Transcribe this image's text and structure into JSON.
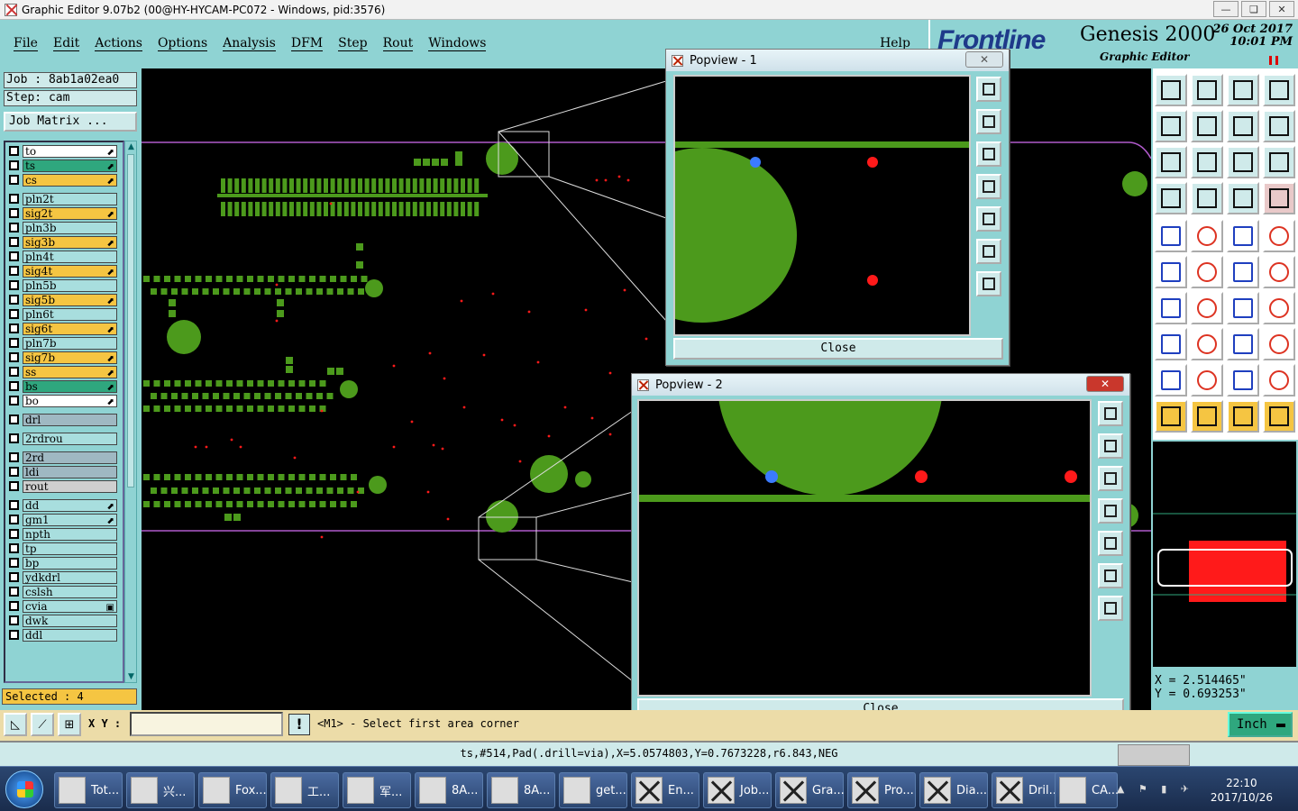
{
  "window": {
    "title": "Graphic Editor 9.07b2 (00@HY-HYCAM-PC072 - Windows, pid:3576)",
    "buttons": [
      "—",
      "❏",
      "✕"
    ]
  },
  "menu": {
    "items": [
      "File",
      "Edit",
      "Actions",
      "Options",
      "Analysis",
      "DFM",
      "Step",
      "Rout",
      "Windows"
    ],
    "help": "Help"
  },
  "brand": {
    "logo": "Frontline",
    "product": "Genesis 2000",
    "date": "26 Oct 2017",
    "time": "10:01 PM",
    "subtitle": "Graphic Editor"
  },
  "left": {
    "job": "Job : 8ab1a02ea0",
    "step": "Step: cam",
    "job_matrix": "Job Matrix ...",
    "selected": "Selected : 4",
    "layers": [
      {
        "name": "to",
        "color": "#ffffff",
        "arrow": "⬈"
      },
      {
        "name": "ts",
        "color": "#2fa77e",
        "arrow": "⬈"
      },
      {
        "name": "cs",
        "color": "#f5c542",
        "arrow": "⬈"
      },
      {
        "name": "pln2t",
        "color": "#a8dede",
        "arrow": ""
      },
      {
        "name": "sig2t",
        "color": "#f5c542",
        "arrow": "⬈"
      },
      {
        "name": "pln3b",
        "color": "#a8dede",
        "arrow": ""
      },
      {
        "name": "sig3b",
        "color": "#f5c542",
        "arrow": "⬈"
      },
      {
        "name": "pln4t",
        "color": "#a8dede",
        "arrow": ""
      },
      {
        "name": "sig4t",
        "color": "#f5c542",
        "arrow": "⬈"
      },
      {
        "name": "pln5b",
        "color": "#a8dede",
        "arrow": ""
      },
      {
        "name": "sig5b",
        "color": "#f5c542",
        "arrow": "⬈"
      },
      {
        "name": "pln6t",
        "color": "#a8dede",
        "arrow": ""
      },
      {
        "name": "sig6t",
        "color": "#f5c542",
        "arrow": "⬈"
      },
      {
        "name": "pln7b",
        "color": "#a8dede",
        "arrow": ""
      },
      {
        "name": "sig7b",
        "color": "#f5c542",
        "arrow": "⬈"
      },
      {
        "name": "ss",
        "color": "#f5c542",
        "arrow": "⬈"
      },
      {
        "name": "bs",
        "color": "#2fa77e",
        "arrow": "⬈"
      },
      {
        "name": "bo",
        "color": "#ffffff",
        "arrow": "⬈"
      },
      {
        "name": "drl",
        "color": "#9fb8c2",
        "arrow": ""
      },
      {
        "name": "2rdrou",
        "color": "#a8dede",
        "arrow": ""
      },
      {
        "name": "2rd",
        "color": "#9fb8c2",
        "arrow": ""
      },
      {
        "name": "ldi",
        "color": "#9fb8c2",
        "arrow": ""
      },
      {
        "name": "rout",
        "color": "#cfcfcf",
        "arrow": ""
      },
      {
        "name": "dd",
        "color": "#a8dede",
        "arrow": "⬈"
      },
      {
        "name": "gm1",
        "color": "#a8dede",
        "arrow": "⬈"
      },
      {
        "name": "npth",
        "color": "#a8dede",
        "arrow": ""
      },
      {
        "name": "tp",
        "color": "#a8dede",
        "arrow": ""
      },
      {
        "name": "bp",
        "color": "#a8dede",
        "arrow": ""
      },
      {
        "name": "ydkdrl",
        "color": "#a8dede",
        "arrow": ""
      },
      {
        "name": "cslsh",
        "color": "#a8dede",
        "arrow": ""
      },
      {
        "name": "cvia",
        "color": "#a8dede",
        "arrow": "▣"
      },
      {
        "name": "dwk",
        "color": "#a8dede",
        "arrow": ""
      },
      {
        "name": "ddl",
        "color": "#a8dede",
        "arrow": ""
      }
    ]
  },
  "popview1": {
    "title": "Popview - 1",
    "close": "Close"
  },
  "popview2": {
    "title": "Popview - 2",
    "close": "Close"
  },
  "coords": {
    "x": "X = 2.514465\"",
    "y": "Y = 0.693253\""
  },
  "bottom": {
    "xy_label": "X Y :",
    "xy_value": "",
    "bang": "!",
    "prompt": "<M1> - Select first area corner",
    "units": "Inch"
  },
  "status": "ts,#514,Pad(.drill=via),X=5.0574803,Y=0.7673228,r6.843,NEG",
  "colors": {
    "copper": "#3d8f0a",
    "pad": "#4c9a1c",
    "drill": "#ff1a1a",
    "selected": "#3b7bff",
    "panel": "#8fd3d3"
  },
  "taskbar": {
    "items": [
      "Tot...",
      "兴...",
      "Fox...",
      "工...",
      "军...",
      "8A...",
      "8A...",
      "get...",
      "En...",
      "Job...",
      "Gra...",
      "Pro...",
      "Dia...",
      "Dril...",
      "CA..."
    ],
    "time": "22:10",
    "date": "2017/10/26"
  }
}
